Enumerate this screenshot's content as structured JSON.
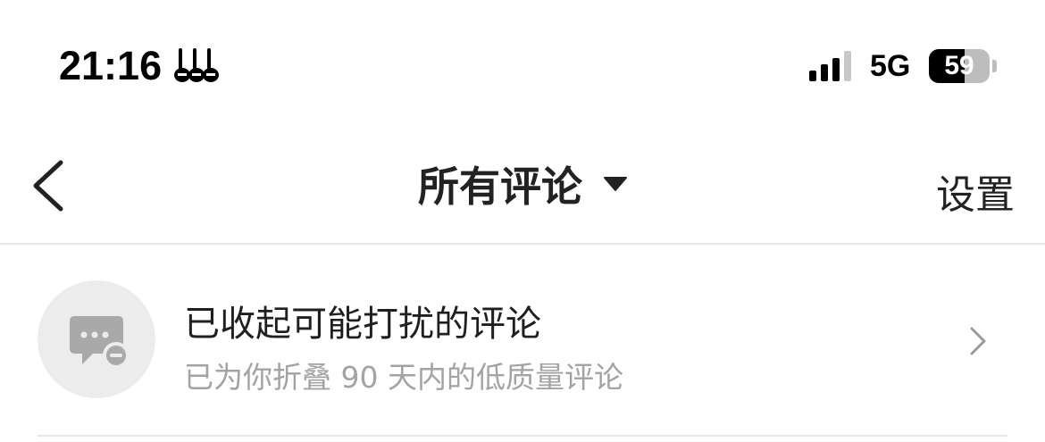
{
  "status_bar": {
    "time": "21:16",
    "network": "5G",
    "battery": "59",
    "battery_level": 0.59,
    "icons": [
      "app-logo-icon",
      "signal-icon",
      "battery-icon"
    ]
  },
  "nav": {
    "title": "所有评论",
    "settings_label": "设置",
    "icons": [
      "back-icon",
      "dropdown-icon"
    ]
  },
  "list": {
    "items": [
      {
        "title": "已收起可能打扰的评论",
        "subtitle": "已为你折叠 90 天内的低质量评论",
        "icon": "folded-comment-icon"
      }
    ]
  },
  "colors": {
    "text_primary": "#1f1f1f",
    "text_secondary": "#a3a3a3",
    "avatar_bg": "#ececec",
    "divider": "#e6e6e6"
  }
}
